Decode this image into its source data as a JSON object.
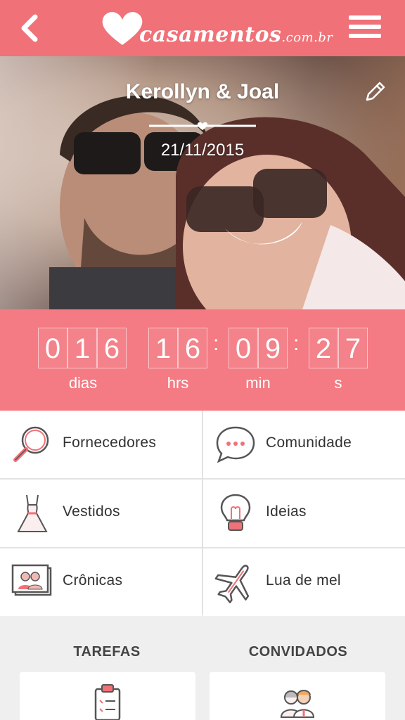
{
  "header": {
    "logo_text": "casamentos",
    "logo_domain": ".com.br",
    "brand_color": "#f07178"
  },
  "hero": {
    "couple_names": "Kerollyn & Joal",
    "wedding_date": "21/11/2015"
  },
  "countdown": {
    "days": [
      "0",
      "1",
      "6"
    ],
    "hours": [
      "1",
      "6"
    ],
    "minutes": [
      "0",
      "9"
    ],
    "seconds": [
      "2",
      "7"
    ],
    "separator": ":",
    "labels": {
      "days": "dias",
      "hours": "hrs",
      "minutes": "min",
      "seconds": "s"
    }
  },
  "menu": {
    "items": [
      {
        "label": "Fornecedores",
        "icon": "magnifier-icon"
      },
      {
        "label": "Comunidade",
        "icon": "chat-bubble-icon"
      },
      {
        "label": "Vestidos",
        "icon": "dress-icon"
      },
      {
        "label": "Ideias",
        "icon": "lightbulb-icon"
      },
      {
        "label": "Crônicas",
        "icon": "photo-couple-icon"
      },
      {
        "label": "Lua de mel",
        "icon": "airplane-icon"
      }
    ]
  },
  "sections": {
    "tasks": {
      "title": "TAREFAS",
      "icon": "clipboard-icon"
    },
    "guests": {
      "title": "CONVIDADOS",
      "icon": "guests-icon"
    }
  }
}
